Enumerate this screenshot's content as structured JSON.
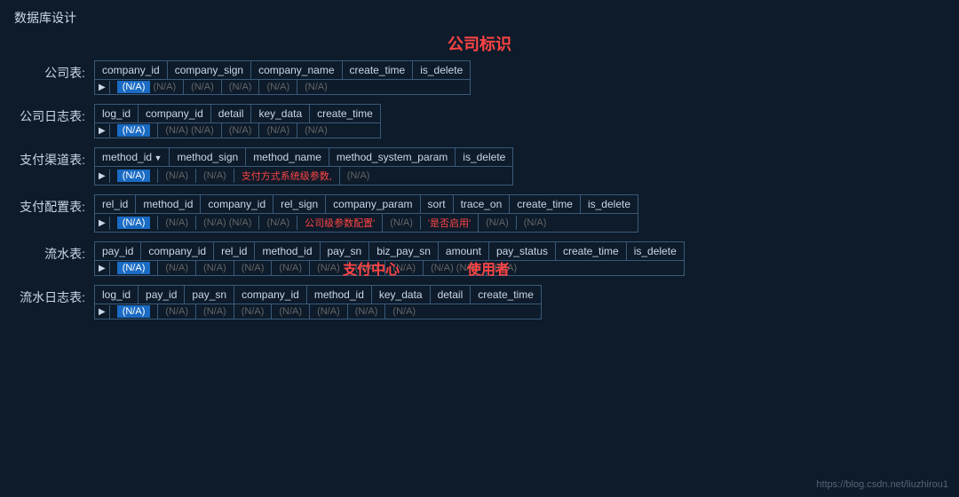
{
  "page": {
    "title": "数据库设计",
    "center_label": "公司标识",
    "footer_url": "https://blog.csdn.net/liuzhirou1"
  },
  "rows": [
    {
      "label": "公司表:",
      "headers": [
        "company_id",
        "company_sign",
        "company_name",
        "create_time",
        "is_delete"
      ],
      "data": [
        "(N/A) (N/A)",
        "(N/A)",
        "(N/A)",
        "(N/A)",
        "(N/A)"
      ],
      "highlight_index": 0,
      "has_arrow_col": false
    },
    {
      "label": "公司日志表:",
      "headers": [
        "log_id",
        "company_id",
        "detail",
        "key_data",
        "create_time"
      ],
      "data": [
        "(N/A)",
        "(N/A) (N/A)",
        "(N/A)",
        "(N/A)",
        ""
      ],
      "highlight_index": 0,
      "has_arrow_col": false
    },
    {
      "label": "支付渠道表:",
      "headers": [
        "method_id",
        "method_sign",
        "method_name",
        "method_system_param",
        "is_delete"
      ],
      "data": [
        "(N/A)",
        "(N/A)",
        "(N/A)",
        "支付方式系统级参数,",
        "(N/A)"
      ],
      "highlight_index": 0,
      "has_arrow_header": true,
      "has_arrow_col": false
    },
    {
      "label": "支付配置表:",
      "headers": [
        "rel_id",
        "method_id",
        "company_id",
        "rel_sign",
        "company_param",
        "sort",
        "trace_on",
        "create_time",
        "is_delete"
      ],
      "data": [
        "(N/A)",
        "(N/A)",
        "(N/A) (N/A)",
        "(N/A)",
        "公司级参数配置'",
        "(N/A)",
        "'是否启用'",
        "(N/A)",
        "(N/A)"
      ],
      "highlight_index": 0,
      "has_arrow_col": false
    },
    {
      "label": "流水表:",
      "headers": [
        "pay_id",
        "company_id",
        "rel_id",
        "method_id",
        "pay_sn",
        "biz_pay_sn",
        "amount",
        "pay_status",
        "create_time",
        "is_delete"
      ],
      "data": [
        "(N/A)",
        "(N/A)",
        "(N/A)",
        "(N/A)",
        "(N/A)",
        "(N/A)",
        "(N/A)",
        "(N/A)",
        "(N/A) (N/A)",
        "(N/A)"
      ],
      "highlight_index": 0,
      "has_arrow_col": false,
      "has_overlay": true
    },
    {
      "label": "流水日志表:",
      "headers": [
        "log_id",
        "pay_id",
        "pay_sn",
        "company_id",
        "method_id",
        "key_data",
        "detail",
        "create_time"
      ],
      "data": [
        "(N/A)",
        "(N/A)",
        "(N/A)",
        "(N/A)",
        "(N/A)",
        "(N/A)",
        "(N/A)",
        "(N/A)"
      ],
      "highlight_index": 0,
      "has_arrow_col": false
    }
  ]
}
